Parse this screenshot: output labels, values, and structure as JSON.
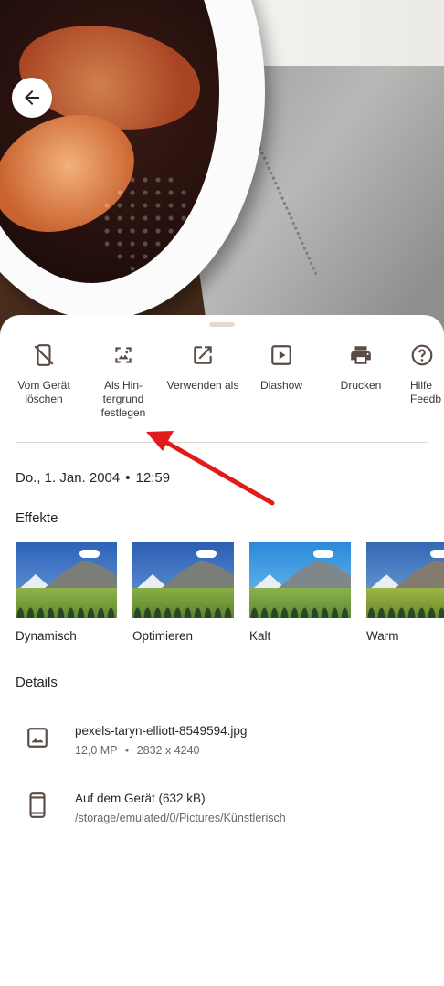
{
  "actions": [
    {
      "label": "Vom Gerät\nlöschen",
      "icon": "phone-delete-icon"
    },
    {
      "label": "Als Hin-\ntergrund\nfestlegen",
      "icon": "wallpaper-icon"
    },
    {
      "label": "Verwenden als",
      "icon": "open-external-icon"
    },
    {
      "label": "Diashow",
      "icon": "slideshow-icon"
    },
    {
      "label": "Drucken",
      "icon": "print-icon"
    },
    {
      "label": "Hilfe\nFeedb",
      "icon": "help-icon"
    }
  ],
  "date": {
    "day": "Do., 1. Jan. 2004",
    "separator": "•",
    "time": "12:59"
  },
  "effects_title": "Effekte",
  "effects": [
    {
      "name": "Dynamisch",
      "tint": "#3f76c8"
    },
    {
      "name": "Optimieren",
      "tint": "#3a6fc2"
    },
    {
      "name": "Kalt",
      "tint": "#3c9be0"
    },
    {
      "name": "Warm",
      "tint": "#3f78c4"
    }
  ],
  "details_title": "Details",
  "file": {
    "name": "pexels-taryn-elliott-8549594.jpg",
    "megapixels": "12,0 MP",
    "separator": "•",
    "resolution": "2832 x 4240"
  },
  "location": {
    "title": "Auf dem Gerät (632 kB)",
    "path": "/storage/emulated/0/Pictures/Künstlerisch"
  },
  "colors": {
    "accent": "#e21a1a",
    "icon": "#5b4b45"
  }
}
